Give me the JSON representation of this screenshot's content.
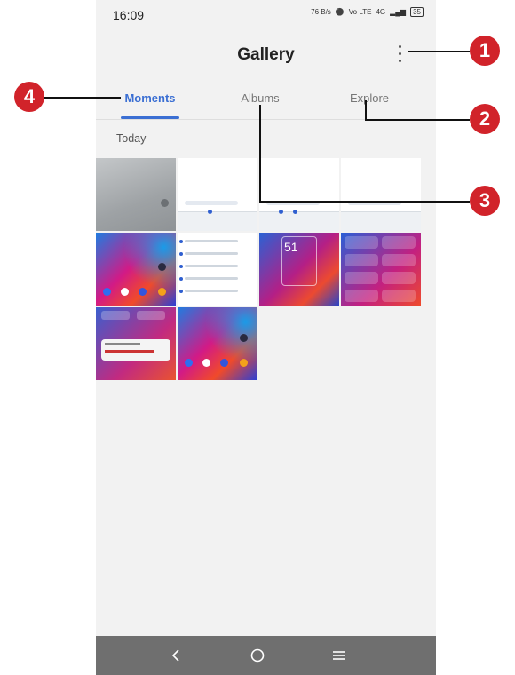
{
  "status_bar": {
    "time": "16:09",
    "net_speed": "76 B/s",
    "volte": "Vo LTE",
    "signal": "4G",
    "battery": "35"
  },
  "app_bar": {
    "title": "Gallery",
    "more_icon": "more-vertical-icon"
  },
  "tabs": [
    {
      "label": "Moments",
      "active": true
    },
    {
      "label": "Albums",
      "active": false
    },
    {
      "label": "Explore",
      "active": false
    }
  ],
  "section": {
    "label": "Today"
  },
  "photos": [
    {
      "name": "photo-gray"
    },
    {
      "name": "photo-keyboard-1"
    },
    {
      "name": "photo-keyboard-2"
    },
    {
      "name": "photo-keyboard-3"
    },
    {
      "name": "photo-wallpaper-home"
    },
    {
      "name": "photo-settings-list"
    },
    {
      "name": "photo-lockscreen"
    },
    {
      "name": "photo-quick-settings"
    },
    {
      "name": "photo-notification"
    },
    {
      "name": "photo-wallpaper-home-2"
    }
  ],
  "lockscreen_clock": "51",
  "nav": {
    "back": "back-icon",
    "home": "home-icon",
    "recents": "recents-icon"
  },
  "callouts": {
    "c1": "1",
    "c2": "2",
    "c3": "3",
    "c4": "4"
  },
  "colors": {
    "accent": "#3b6fd3",
    "callout": "#d1232a",
    "navbar": "#6f6f6f"
  }
}
